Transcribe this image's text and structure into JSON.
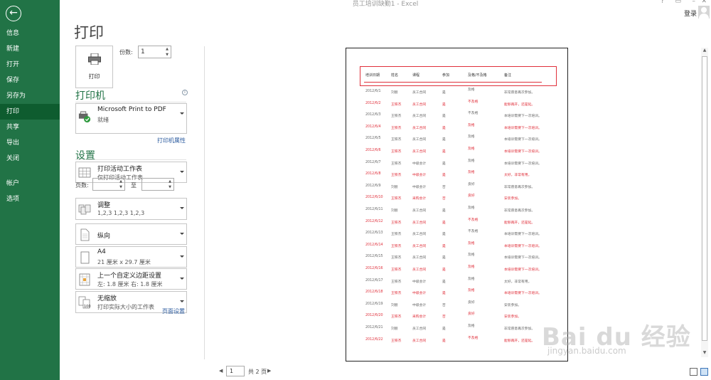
{
  "window": {
    "title": "员工培训缺勤1 - Excel",
    "help": "?",
    "login": "登录"
  },
  "nav": {
    "items": [
      "信息",
      "新建",
      "打开",
      "保存",
      "另存为",
      "打印",
      "共享",
      "导出",
      "关闭"
    ],
    "bottom_items": [
      "帐户",
      "选项"
    ],
    "active_index": 5
  },
  "print": {
    "title": "打印",
    "button_label": "打印",
    "copies_label": "份数:",
    "copies_value": "1",
    "printer_section": "打印机",
    "printer_name": "Microsoft Print to PDF",
    "printer_status": "就绪",
    "printer_props_link": "打印机属性",
    "settings_section": "设置",
    "settings": [
      {
        "l1": "打印活动工作表",
        "l2": "仅打印活动工作表",
        "icon": "grid-icon"
      },
      {
        "l1": "调整",
        "l2": "1,2,3     1,2,3     1,2,3",
        "icon": "collate-icon"
      },
      {
        "l1": "纵向",
        "l2": "",
        "icon": "portrait-icon"
      },
      {
        "l1": "A4",
        "l2": "21 厘米 x 29.7 厘米",
        "icon": "paper-icon"
      },
      {
        "l1": "上一个自定义边距设置",
        "l2": "左: 1.8 厘米    右: 1.8 厘米",
        "icon": "margins-icon"
      },
      {
        "l1": "无缩放",
        "l2": "打印实际大小的工作表",
        "icon": "scaling-icon"
      }
    ],
    "pages_label": "页数:",
    "to_label": "至",
    "page_setup_link": "页面设置"
  },
  "preview": {
    "headers": [
      "培训日期",
      "姓名",
      "课程",
      "参加",
      "及格/不及格",
      "备注"
    ],
    "rows": [
      [
        "2012/6/1",
        "刘丽",
        "员工合同",
        "是",
        "及格",
        "非常愿意再次参加。",
        false
      ],
      [
        "2012/6/2",
        "王铁杰",
        "员工合同",
        "是",
        "不及格",
        "能够再开，还是延。",
        true
      ],
      [
        "2012/6/3",
        "王铁杰",
        "员工合同",
        "是",
        "不及格",
        "本培训需要下一次培训。",
        false
      ],
      [
        "2012/6/4",
        "王铁杰",
        "员工合同",
        "是",
        "及格",
        "本培训需要下一次培训。",
        true
      ],
      [
        "2012/6/5",
        "王铁杰",
        "员工合同",
        "是",
        "及格",
        "本培训需要下一次培训。",
        false
      ],
      [
        "2012/6/6",
        "王铁杰",
        "员工合同",
        "是",
        "及格",
        "本培训需要下一次培训。",
        true
      ],
      [
        "2012/6/7",
        "王铁杰",
        "中级会计",
        "是",
        "及格",
        "本培训需要下一次培训。",
        false
      ],
      [
        "2012/6/8",
        "王铁杰",
        "中级会计",
        "是",
        "及格",
        "太好，非常有用。",
        true
      ],
      [
        "2012/6/9",
        "刘丽",
        "中级会计",
        "否",
        "良好",
        "非常愿意再次参加。",
        false
      ],
      [
        "2012/6/10",
        "王铁杰",
        "采购会计",
        "否",
        "良好",
        "安装参加。",
        true
      ],
      [
        "2012/6/11",
        "刘丽",
        "员工合同",
        "是",
        "及格",
        "非常愿意再次参加。",
        false
      ],
      [
        "2012/6/12",
        "王铁杰",
        "员工合同",
        "是",
        "不及格",
        "能够再开，还是延。",
        true
      ],
      [
        "2012/6/13",
        "王铁杰",
        "员工合同",
        "是",
        "不及格",
        "本培训需要下一次培训。",
        false
      ],
      [
        "2012/6/14",
        "王铁杰",
        "员工合同",
        "是",
        "及格",
        "本培训需要下一次培训。",
        true
      ],
      [
        "2012/6/15",
        "王铁杰",
        "员工合同",
        "是",
        "及格",
        "本培训需要下一次培训。",
        false
      ],
      [
        "2012/6/16",
        "王铁杰",
        "员工合同",
        "是",
        "及格",
        "本培训需要下一次培训。",
        true
      ],
      [
        "2012/6/17",
        "王铁杰",
        "中级会计",
        "是",
        "及格",
        "太好，非常有用。",
        false
      ],
      [
        "2012/6/18",
        "王铁杰",
        "中级会计",
        "是",
        "及格",
        "本培训需要下一次培训。",
        true
      ],
      [
        "2012/6/19",
        "刘丽",
        "中级会计",
        "否",
        "良好",
        "安装参加。",
        false
      ],
      [
        "2012/6/20",
        "王铁杰",
        "采购会计",
        "否",
        "良好",
        "安装参加。",
        true
      ],
      [
        "2012/6/21",
        "刘丽",
        "员工合同",
        "是",
        "及格",
        "非常愿意再次参加。",
        false
      ],
      [
        "2012/6/22",
        "王铁杰",
        "员工合同",
        "是",
        "不及格",
        "能够再开，还是延。",
        true
      ]
    ]
  },
  "pager": {
    "current": "1",
    "of_label": "共 2 页"
  },
  "watermark": {
    "brand": "Bai du 经验",
    "url": "jingyan.baidu.com"
  },
  "colors": {
    "accent": "#217346",
    "highlight": "#e0303b",
    "link": "#2a5a9e"
  }
}
